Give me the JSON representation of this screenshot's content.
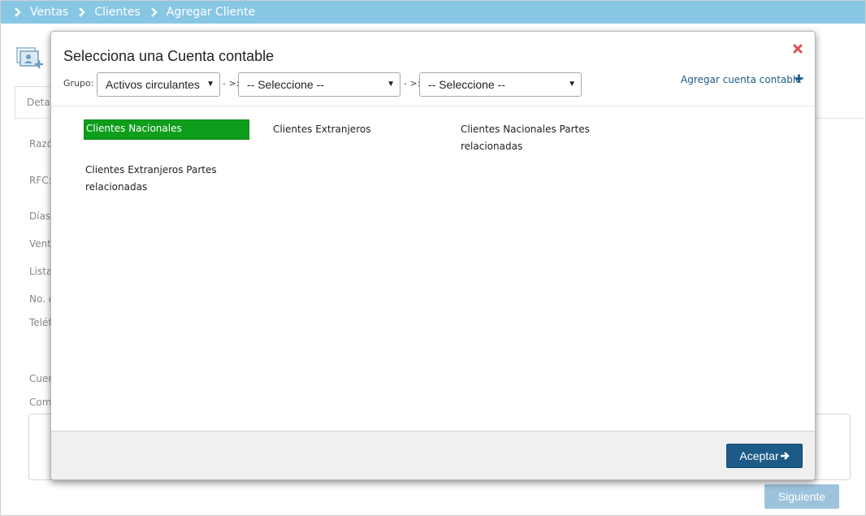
{
  "breadcrumb": [
    "Ventas",
    "Clientes",
    "Agregar Cliente"
  ],
  "background": {
    "tab_label": "Detal",
    "field_labels": [
      "Razó",
      "RFC:",
      "Días",
      "Vent",
      "Lista",
      "No. d",
      "Teléf",
      "Cuen",
      "Com"
    ],
    "next_button": "Siguiente"
  },
  "modal": {
    "title": "Selecciona una Cuenta contable",
    "grupo_label": "Grupo:",
    "grupo_value": "Activos circulantes",
    "separator": "- >:",
    "select2_value": "-- Seleccione --",
    "select3_value": "-- Seleccione --",
    "add_link": "Agregar cuenta contable",
    "accounts": [
      "Clientes Nacionales",
      "Clientes Extranjeros",
      "Clientes Nacionales Partes relacionadas",
      "Clientes Extranjeros Partes relacionadas"
    ],
    "selected_account": "Clientes Nacionales",
    "accept_button": "Aceptar"
  },
  "colors": {
    "breadcrumb_bar": "#87c7e4",
    "selected": "#0f9d1c",
    "primary_button": "#1c5b87",
    "close_icon": "#e0504f"
  }
}
